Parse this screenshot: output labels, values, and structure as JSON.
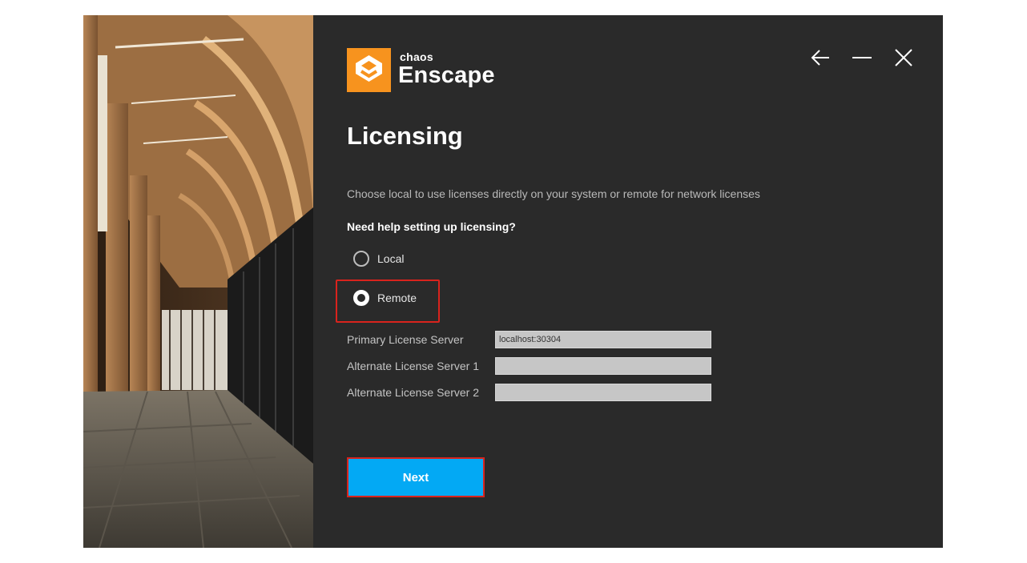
{
  "brand": {
    "small": "chaos",
    "big": "Enscape",
    "accent_color": "#f7931e"
  },
  "window_controls": {
    "back_icon": "arrow-left-icon",
    "minimize_icon": "minimize-icon",
    "close_icon": "close-icon"
  },
  "page": {
    "title": "Licensing",
    "subtitle": "Choose local to use licenses directly on your system or remote for network licenses",
    "help_text": "Need help setting up licensing?"
  },
  "license_mode": {
    "options": [
      {
        "label": "Local",
        "selected": false
      },
      {
        "label": "Remote",
        "selected": true
      }
    ]
  },
  "servers": {
    "primary_label": "Primary License Server",
    "primary_value": "localhost:30304",
    "alternate1_label": "Alternate License Server 1",
    "alternate1_value": "",
    "alternate2_label": "Alternate License Server 2",
    "alternate2_value": ""
  },
  "actions": {
    "next_label": "Next",
    "next_color": "#03a9f4"
  },
  "annotation_color": "#d9231d"
}
